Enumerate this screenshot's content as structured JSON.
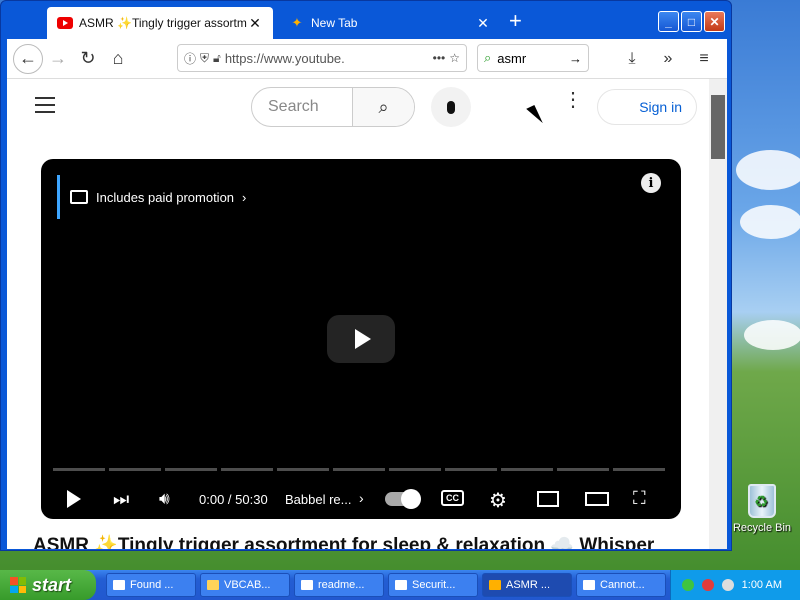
{
  "browser": {
    "tabs": [
      {
        "title": "ASMR ✨Tingly trigger assortment"
      },
      {
        "title": "New Tab"
      }
    ],
    "url": "https://www.youtube.",
    "search_value": "asmr"
  },
  "youtube": {
    "search_placeholder": "Search",
    "sign_in": "Sign in",
    "promo_text": "Includes paid promotion",
    "time": "0:00 / 50:30",
    "chapter": "Babbel re...",
    "video_title": "ASMR ✨Tingly trigger assortment for sleep & relaxation ☁️ Whisper"
  },
  "desktop": {
    "recycle_bin_label": "Recycle Bin"
  },
  "taskbar": {
    "start_label": "start",
    "tasks": [
      {
        "label": "Found ..."
      },
      {
        "label": "VBCAB..."
      },
      {
        "label": "readme..."
      },
      {
        "label": "Securit..."
      },
      {
        "label": "ASMR ..."
      },
      {
        "label": "Cannot..."
      }
    ],
    "clock": "1:00 AM"
  },
  "colors": {
    "xp_blue": "#0a58d8",
    "youtube_red": "#e00000",
    "link_blue": "#065fd4",
    "start_green": "#379b2b"
  }
}
